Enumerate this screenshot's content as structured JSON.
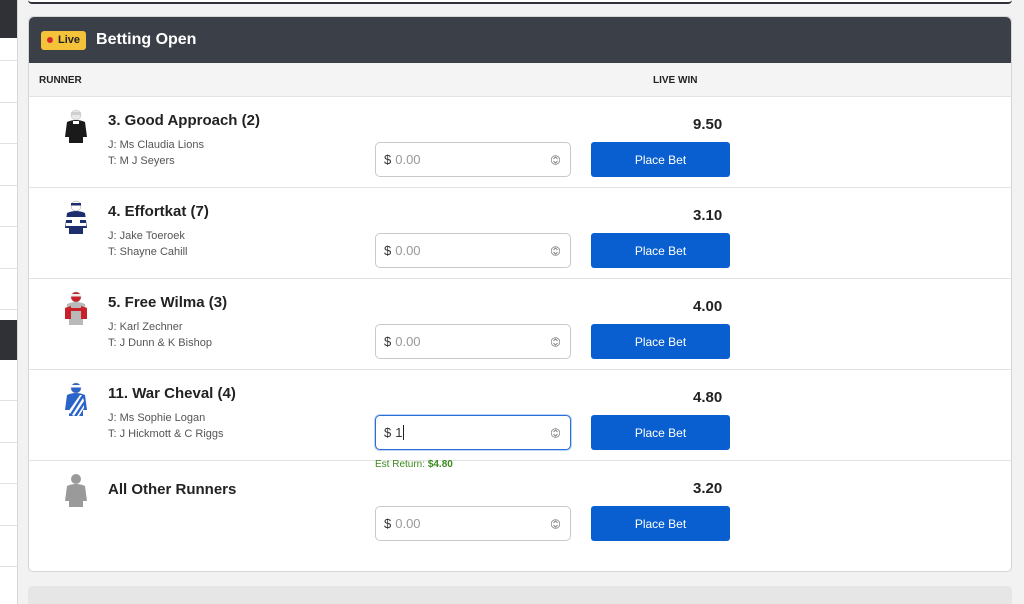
{
  "header": {
    "live_label": "Live",
    "title": "Betting Open"
  },
  "columns": {
    "runner": "RUNNER",
    "live_win": "LIVE WIN"
  },
  "colors": {
    "header_bg": "#3b3f47",
    "live_badge": "#f4c33a",
    "place_bet": "#0a5fd0",
    "est_return": "#3a8a1e"
  },
  "runners": [
    {
      "name": "3. Good Approach (2)",
      "jockey": "J: Ms Claudia Lions",
      "trainer": "T: M J Seyers",
      "odds": "9.50",
      "currency": "$",
      "stake_placeholder": "0.00",
      "button": "Place Bet",
      "silk": "black-silk-icon"
    },
    {
      "name": "4. Effortkat (7)",
      "jockey": "J: Jake Toeroek",
      "trainer": "T: Shayne Cahill",
      "odds": "3.10",
      "currency": "$",
      "stake_placeholder": "0.00",
      "button": "Place Bet",
      "silk": "navy-hoops-silk-icon"
    },
    {
      "name": "5. Free Wilma (3)",
      "jockey": "J: Karl Zechner",
      "trainer": "T: J Dunn & K Bishop",
      "odds": "4.00",
      "currency": "$",
      "stake_placeholder": "0.00",
      "button": "Place Bet",
      "silk": "red-grey-silk-icon"
    },
    {
      "name": "11. War Cheval (4)",
      "jockey": "J: Ms Sophie Logan",
      "trainer": "T: J Hickmott & C Riggs",
      "odds": "4.80",
      "currency": "$",
      "stake_value": "1",
      "button": "Place Bet",
      "silk": "blue-stripes-silk-icon",
      "est_label": "Est Return:",
      "est_value": "$4.80"
    },
    {
      "name": "All Other Runners",
      "jockey": "",
      "trainer": "",
      "odds": "3.20",
      "currency": "$",
      "stake_placeholder": "0.00",
      "button": "Place Bet",
      "silk": "grey-silk-icon"
    }
  ]
}
